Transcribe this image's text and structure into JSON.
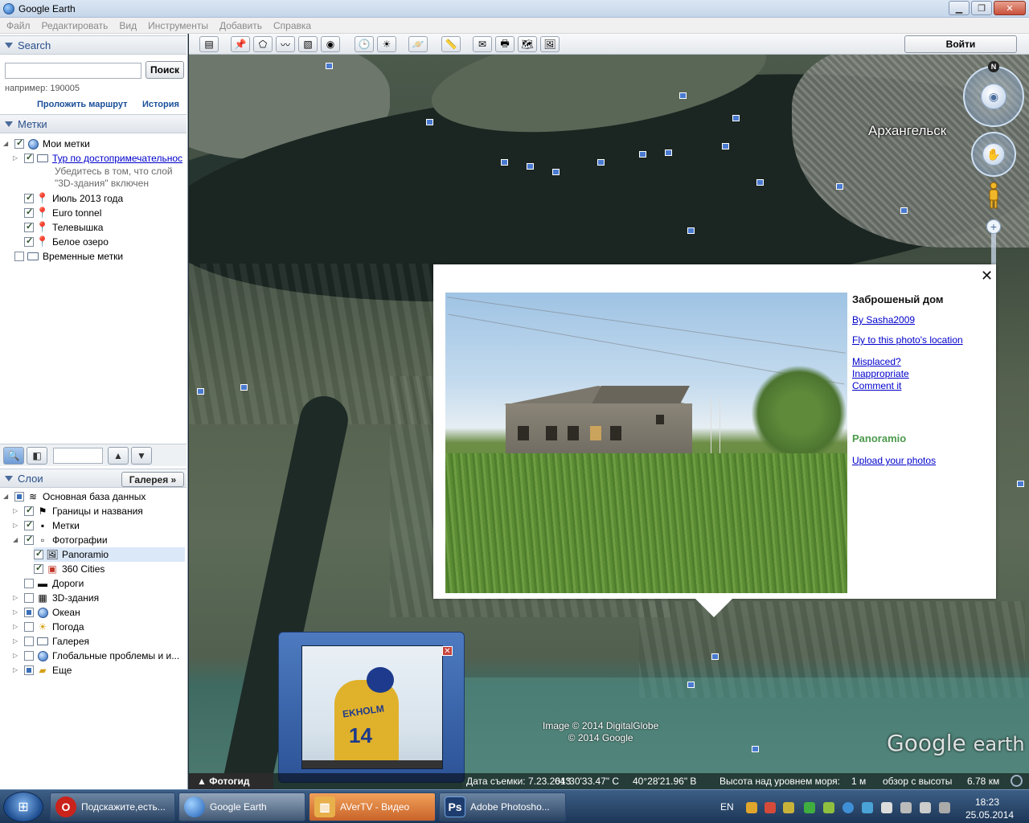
{
  "window": {
    "title": "Google Earth"
  },
  "menu": [
    "Файл",
    "Редактировать",
    "Вид",
    "Инструменты",
    "Добавить",
    "Справка"
  ],
  "search": {
    "header": "Search",
    "button": "Поиск",
    "hint": "например: 190005",
    "route_link": "Проложить маршрут",
    "history_link": "История"
  },
  "places": {
    "header": "Метки",
    "items": [
      {
        "label": "Мои метки"
      },
      {
        "label": "Тур по достопримечательнос"
      },
      {
        "label": "Убедитесь в том, что слой"
      },
      {
        "label": "\"3D-здания\" включен"
      },
      {
        "label": "Июль 2013 года"
      },
      {
        "label": "Euro tonnel"
      },
      {
        "label": "Телевышка"
      },
      {
        "label": "Белое озеро"
      },
      {
        "label": "Временные метки"
      }
    ]
  },
  "layers": {
    "header": "Слои",
    "gallery_button": "Галерея",
    "items": [
      {
        "label": "Основная база данных"
      },
      {
        "label": "Границы и названия"
      },
      {
        "label": "Метки"
      },
      {
        "label": "Фотографии"
      },
      {
        "label": "Panoramio"
      },
      {
        "label": "360 Cities"
      },
      {
        "label": "Дороги"
      },
      {
        "label": "3D-здания"
      },
      {
        "label": "Океан"
      },
      {
        "label": "Погода"
      },
      {
        "label": "Галерея"
      },
      {
        "label": "Глобальные проблемы и и..."
      },
      {
        "label": "Еще"
      }
    ]
  },
  "toolbar": {
    "signin": "Войти"
  },
  "map": {
    "city_label": "Архангельск",
    "north": "N",
    "credit_line1": "Image © 2014 DigitalGlobe",
    "credit_line2": "© 2014 Google",
    "logo_google": "Google",
    "logo_earth": "earth"
  },
  "balloon": {
    "title": "Заброшеный дом",
    "author_link": "By Sasha2009",
    "fly_link": "Fly to this photo's location",
    "misplaced_link": "Misplaced?",
    "inappropriate_link": "Inappropriate",
    "comment_link": "Comment it",
    "panoramio": "Panoramio",
    "upload_link": "Upload your photos",
    "close": "✕"
  },
  "tv": {
    "player_name": "EKHOLM",
    "player_number": "14"
  },
  "status": {
    "tour_guide": "Фотогид",
    "date": "Дата съемки: 7.23.2013",
    "lat": "64°30'33.47\" С",
    "lon": "40°28'21.96\" В",
    "elev_label": "Высота над уровнем моря:",
    "elev_value": "1 м",
    "eye_label": "обзор с высоты",
    "eye_value": "6.78 км"
  },
  "taskbar": {
    "tasks": [
      {
        "label": "Подскажите,есть..."
      },
      {
        "label": "Google Earth"
      },
      {
        "label": "AVerTV - Видео"
      },
      {
        "label": "Adobe Photosho..."
      }
    ],
    "lang": "EN",
    "time": "18:23",
    "date": "25.05.2014"
  },
  "colors": {
    "link": "#0000cc",
    "accent": "#2a4f8a",
    "panoramio_green": "#4c9a4c"
  }
}
